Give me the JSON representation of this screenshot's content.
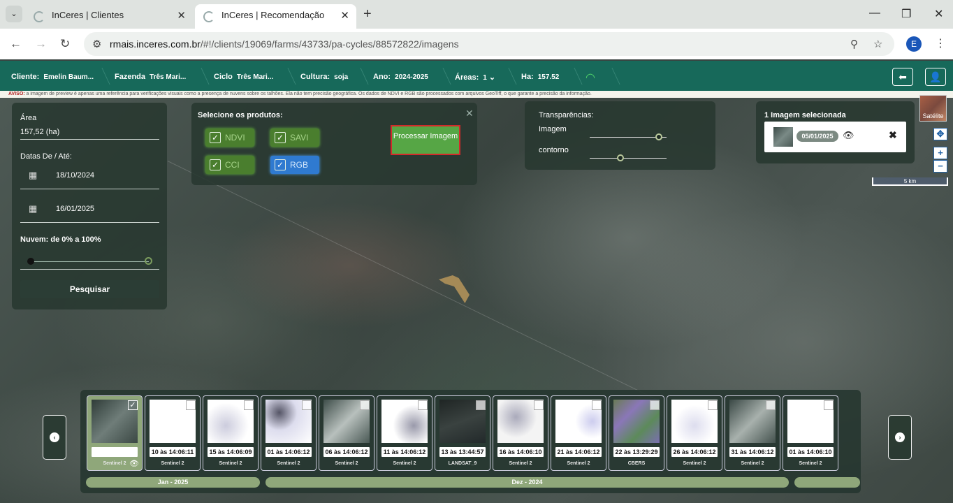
{
  "browser": {
    "tabs": [
      {
        "title": "InCeres | Clientes"
      },
      {
        "title": "InCeres | Recomendação"
      }
    ],
    "url_domain": "rmais.inceres.com.br",
    "url_path": "/#!/clients/19069/farms/43733/pa-cycles/88572822/imagens",
    "profile_initial": "E"
  },
  "appbar": {
    "cliente_label": "Cliente:",
    "cliente_value": "Emelin Baum...",
    "fazenda_label": "Fazenda",
    "fazenda_value": "Três Mari...",
    "ciclo_label": "Ciclo",
    "ciclo_value": "Três Mari...",
    "cultura_label": "Cultura:",
    "cultura_value": "soja",
    "ano_label": "Ano:",
    "ano_value": "2024-2025",
    "areas_label": "Áreas:",
    "areas_value": "1",
    "ha_label": "Ha:",
    "ha_value": "157.52"
  },
  "notice": {
    "prefix": "AVISO:",
    "text": " a imagem de preview é apenas uma referência para verificações visuais como a presença de nuvens sobre os talhões. Ela não tem precisão geográfica. Os dados de NDVI e RGB são processados com arquivos GeoTiff, o que garante a precisão da informação."
  },
  "filters": {
    "area_label": "Área",
    "area_value": "157,52 (ha)",
    "dates_label": "Datas De / Até:",
    "date_from": "18/10/2024",
    "date_to": "16/01/2025",
    "cloud_label": "Nuvem: de 0% a 100%",
    "cloud_min": 0,
    "cloud_max": 100,
    "search_button": "Pesquisar"
  },
  "products": {
    "title": "Selecione os produtos:",
    "items": [
      "NDVI",
      "SAVI",
      "CCI",
      "RGB"
    ],
    "process_button": "Processar Imagem"
  },
  "transparency": {
    "title": "Transparências:",
    "image_label": "Imagem",
    "image_value": 0.9,
    "contour_label": "contorno",
    "contour_value": 0.4
  },
  "selected": {
    "title": "1 Imagem selecionada",
    "date": "05/01/2025"
  },
  "map": {
    "layer_label": "Satélite",
    "scale_label": "5 km"
  },
  "images": [
    {
      "time": "",
      "source": "Sentinel 2",
      "selected": true
    },
    {
      "time": "10 às 14:06:11",
      "source": "Sentinel 2"
    },
    {
      "time": "15 às 14:06:09",
      "source": "Sentinel 2"
    },
    {
      "time": "01 às 14:06:12",
      "source": "Sentinel 2"
    },
    {
      "time": "06 às 14:06:12",
      "source": "Sentinel 2"
    },
    {
      "time": "11 às 14:06:12",
      "source": "Sentinel 2"
    },
    {
      "time": "13 às 13:44:57",
      "source": "LANDSAT_9"
    },
    {
      "time": "16 às 14:06:10",
      "source": "Sentinel 2"
    },
    {
      "time": "21 às 14:06:12",
      "source": "Sentinel 2"
    },
    {
      "time": "22 às 13:29:29",
      "source": "CBERS"
    },
    {
      "time": "26 às 14:06:12",
      "source": "Sentinel 2"
    },
    {
      "time": "31 às 14:06:12",
      "source": "Sentinel 2"
    },
    {
      "time": "01 às 14:06:10",
      "source": "Sentinel 2"
    }
  ],
  "months": [
    "Jan - 2025",
    "Dez - 2024",
    ""
  ]
}
